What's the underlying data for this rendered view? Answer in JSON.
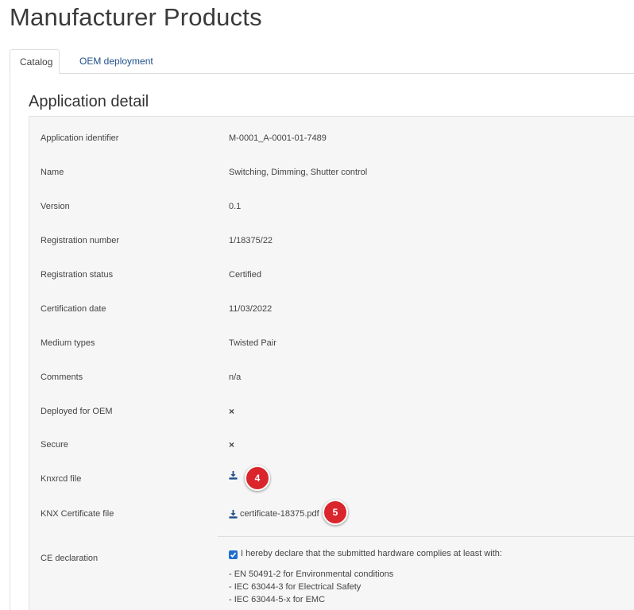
{
  "page_title": "Manufacturer Products",
  "tabs": [
    {
      "label": "Catalog",
      "active": true
    },
    {
      "label": "OEM deployment",
      "active": false
    }
  ],
  "section_title": "Application detail",
  "rows": [
    {
      "label": "Application identifier",
      "value": "M-0001_A-0001-01-7489"
    },
    {
      "label": "Name",
      "value": "Switching, Dimming, Shutter control"
    },
    {
      "label": "Version",
      "value": "0.1"
    },
    {
      "label": "Registration number",
      "value": "1/18375/22"
    },
    {
      "label": "Registration status",
      "value": "Certified"
    },
    {
      "label": "Certification date",
      "value": "11/03/2022"
    },
    {
      "label": "Medium types",
      "value": "Twisted Pair"
    },
    {
      "label": "Comments",
      "value": "n/a"
    },
    {
      "label": "Deployed for OEM",
      "value": "×",
      "icon": "x-icon"
    },
    {
      "label": "Secure",
      "value": "×",
      "icon": "x-icon"
    },
    {
      "label": "Knxrcd file",
      "icon": "download-icon"
    },
    {
      "label": "KNX Certificate file",
      "value": "certificate-18375.pdf",
      "icon": "download-icon"
    }
  ],
  "ce": {
    "label": "CE declaration",
    "checked": true,
    "declaration": "I hereby declare that the submitted hardware complies at least with:",
    "items": [
      "- EN 50491-2 for Environmental conditions",
      "- IEC 63044-3 for Electrical Safety",
      "- IEC 63044-5-x for EMC"
    ]
  },
  "annotations": [
    "4",
    "5"
  ],
  "colors": {
    "link": "#1f4e8a",
    "badge": "#d9252b",
    "panel_bg": "#f6f6f6",
    "checkbox": "#1f6fcf"
  }
}
